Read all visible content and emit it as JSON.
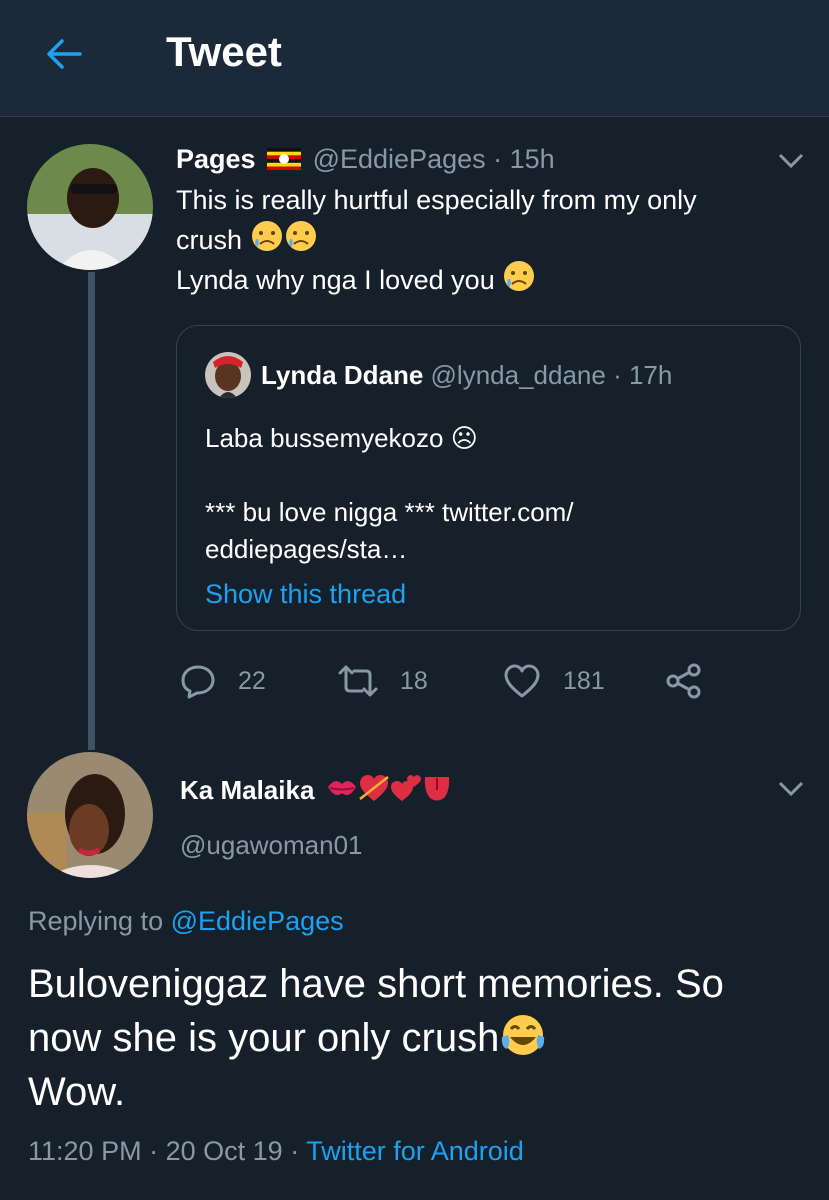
{
  "header": {
    "title": "Tweet"
  },
  "tweet": {
    "author_name": "Pages",
    "handle": "@EddiePages",
    "time": "· 15h",
    "text_line1": "This is really hurtful especially from my only",
    "text_line2": "crush",
    "text_line3": "Lynda why nga I loved you",
    "quoted": {
      "author_name": "Lynda Ddane",
      "handle": "@lynda_ddane",
      "time": "· 17h",
      "text_line1": "Laba bussemyekozo ☹",
      "text_line2": "*** bu love nigga *** twitter.com/",
      "text_line3": "eddiepages/sta…",
      "show_thread": "Show this thread"
    },
    "actions": {
      "replies": "22",
      "retweets": "18",
      "likes": "181"
    }
  },
  "reply": {
    "author_name": "Ka Malaika",
    "handle": "@ugawoman01",
    "replying_prefix": "Replying to",
    "replying_to": "@EddiePages",
    "text_line1": "Buloveniggaz have short memories. So",
    "text_line2": "now she is your only crush",
    "text_line3": "Wow.",
    "time": "11:20 PM",
    "date": "20 Oct 19",
    "source": "Twitter for Android"
  },
  "colors": {
    "background": "#15202b",
    "header": "#1c2938",
    "accent": "#1da1f2",
    "muted": "#8899a6",
    "border": "#38444d"
  },
  "icons": [
    "back-arrow-icon",
    "chevron-down-icon",
    "reply-icon",
    "retweet-icon",
    "like-icon",
    "share-icon",
    "uganda-flag-icon"
  ]
}
